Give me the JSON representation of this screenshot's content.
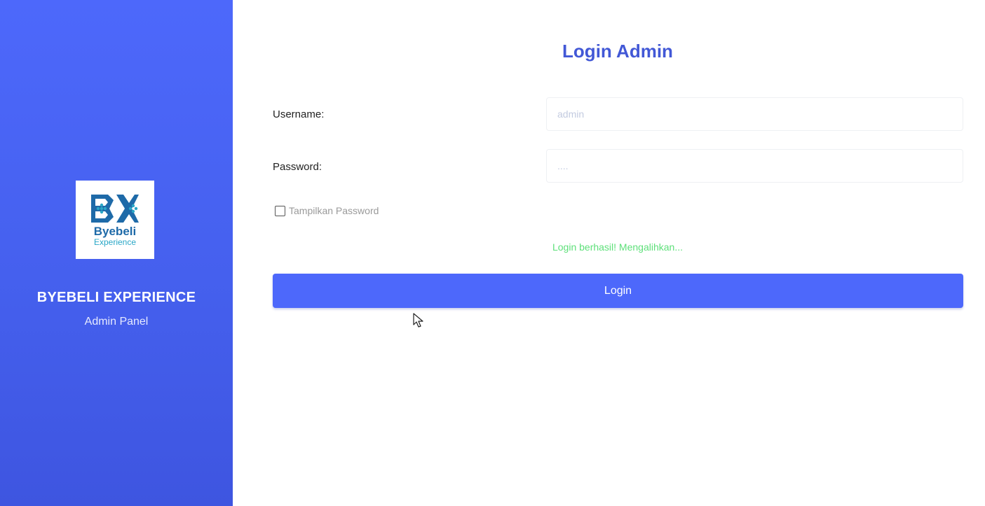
{
  "sidebar": {
    "logo_word": "Byebeli",
    "logo_sub": "Experience",
    "brand_title": "BYEBELI EXPERIENCE",
    "brand_subtitle": "Admin Panel",
    "logo_icon": "controller-bx-logo-icon"
  },
  "form": {
    "title": "Login Admin",
    "username_label": "Username:",
    "username_value": "admin",
    "password_label": "Password:",
    "password_value": "....",
    "show_password_label": "Tampilkan Password",
    "show_password_checked": false,
    "status_message": "Login berhasil! Mengalihkan...",
    "login_button_label": "Login"
  },
  "colors": {
    "accent": "#4d68fb",
    "title": "#4258d6",
    "success": "#5ee07a"
  }
}
